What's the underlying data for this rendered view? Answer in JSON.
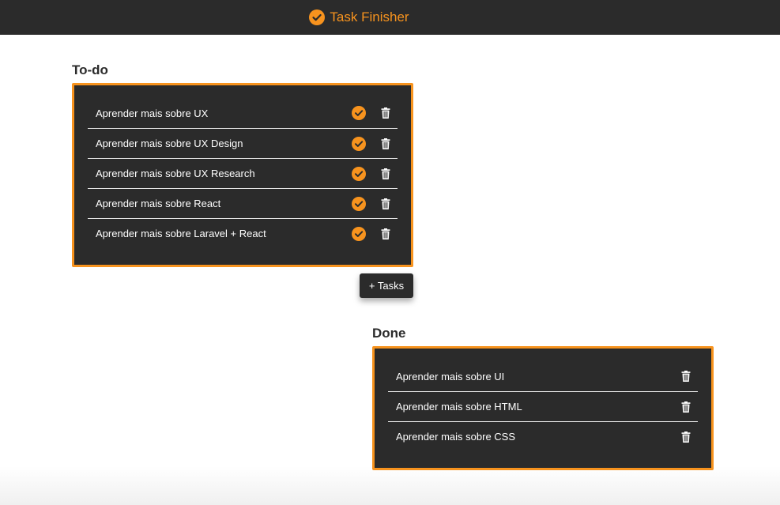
{
  "app": {
    "title": "Task Finisher",
    "accent_color": "#f7931e",
    "dark_color": "#2b2b2b"
  },
  "todo": {
    "title": "To-do",
    "tasks": [
      "Aprender mais sobre UX",
      "Aprender mais sobre UX Design",
      "Aprender mais sobre UX Research",
      "Aprender mais sobre React",
      "Aprender mais sobre Laravel + React"
    ]
  },
  "add_button": {
    "label": "+ Tasks"
  },
  "done": {
    "title": "Done",
    "tasks": [
      "Aprender mais sobre UI",
      "Aprender mais sobre HTML",
      "Aprender mais sobre CSS"
    ]
  },
  "icons": {
    "brand": "check-circle-icon",
    "complete": "check-circle-icon",
    "delete": "trash-icon"
  }
}
